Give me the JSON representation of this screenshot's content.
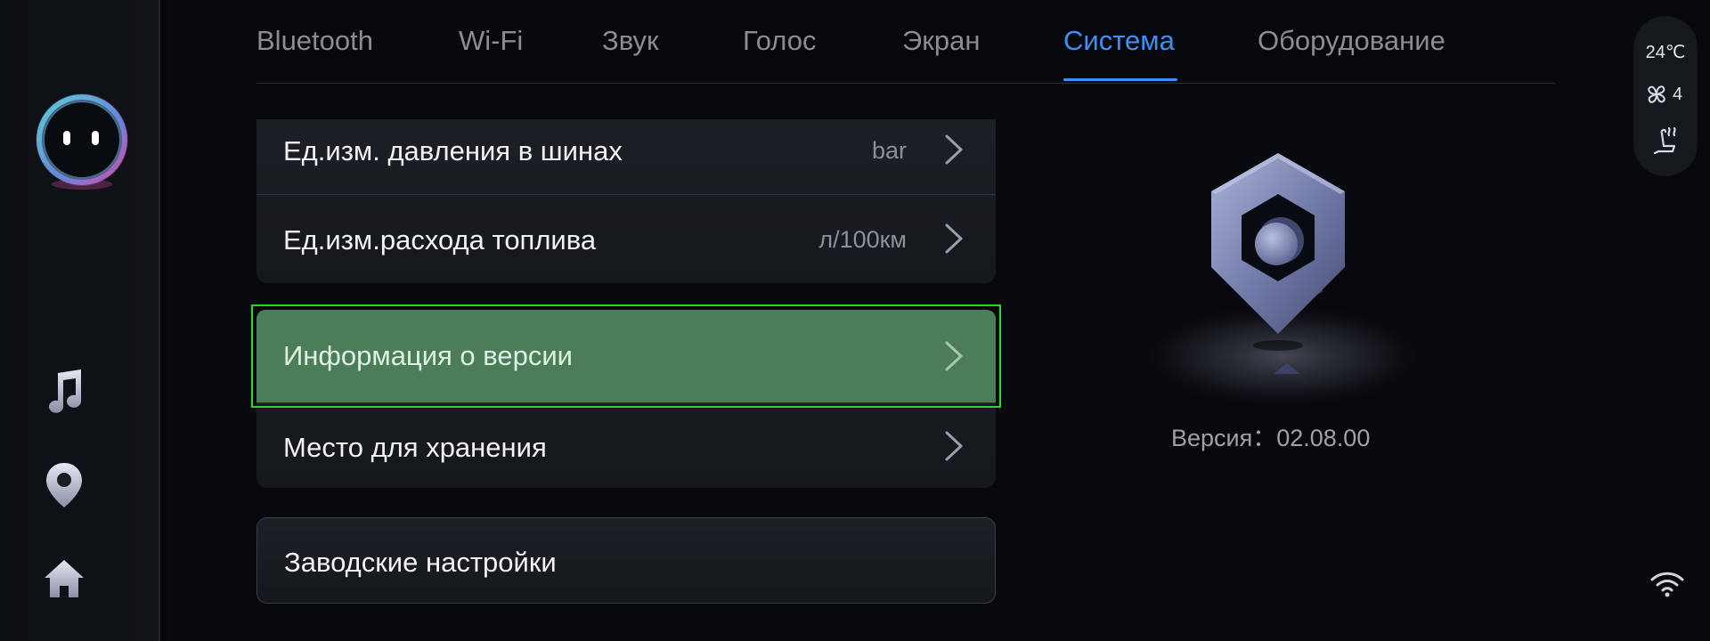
{
  "tabs": [
    {
      "label": "Bluetooth",
      "active": false
    },
    {
      "label": "Wi-Fi",
      "active": false
    },
    {
      "label": "Звук",
      "active": false
    },
    {
      "label": "Голос",
      "active": false
    },
    {
      "label": "Экран",
      "active": false
    },
    {
      "label": "Система",
      "active": true
    },
    {
      "label": "Оборудование",
      "active": false
    }
  ],
  "settings": {
    "units_group": [
      {
        "label": "Ед.изм. давления в шинах",
        "value": "bar"
      },
      {
        "label": "Ед.изм.расхода топлива",
        "value": "л/100км"
      }
    ],
    "info_group": [
      {
        "label": "Информация о версии",
        "selected": true
      },
      {
        "label": "Место для хранения"
      }
    ],
    "factory_reset": {
      "label": "Заводские настройки"
    }
  },
  "version_info": {
    "text": "Версия：02.08.00"
  },
  "status": {
    "temperature": "24℃",
    "fan_level": "4",
    "fan_icon": "fan-icon",
    "seat_icon": "seat-heating-icon",
    "wifi_icon": "wifi-icon"
  },
  "dock": {
    "assistant_icon": "assistant-avatar-icon",
    "items": [
      "music-icon",
      "navigation-icon",
      "home-icon"
    ]
  },
  "colors": {
    "accent": "#3f8ff2",
    "selected_row": "#4b7d58",
    "highlight_border": "#2fd52f"
  }
}
